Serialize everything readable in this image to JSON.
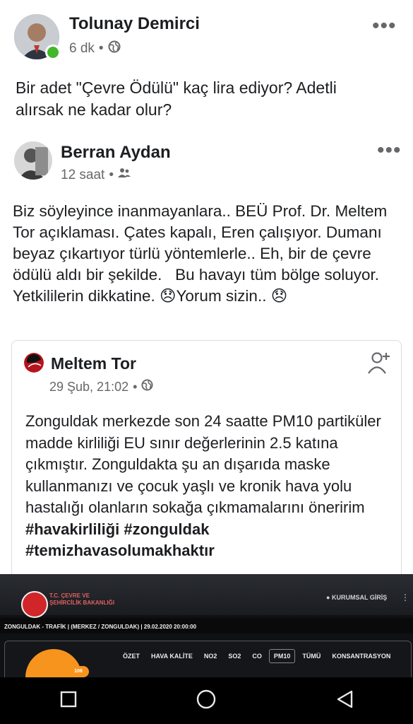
{
  "post": {
    "author": "Tolunay Demirci",
    "time": "6 dk",
    "privacy_icon": "globe-icon",
    "text": "Bir adet \"Çevre Ödülü\" kaç lira ediyor? Adetli alırsak ne kadar olur?"
  },
  "shared": {
    "author": "Berran Aydan",
    "time": "12 saat",
    "privacy_icon": "friends-icon",
    "text": "Biz söyleyince inanmayanlara.. BEÜ Prof. Dr. Meltem Tor açıklaması. Çates kapalı, Eren çalışıyor. Dumanı beyaz çıkartıyor türlü yöntemlerle.. Eh, bir de çevre ödülü aldı bir şekilde.   Bu havayı tüm bölge soluyor. Yetkililerin dikkatine. 😞Yorum sizin.. 😞"
  },
  "inner": {
    "author": "Meltem Tor",
    "time": "29 Şub, 21:02",
    "privacy_icon": "globe-icon",
    "text": "Zonguldak merkezde son 24 saatte PM10 partiküler madde kirliliği EU sınır değerlerinin 2.5 katına çıkmıştır. Zonguldakta şu an dışarıda maske kullanmanızı ve çocuk yaşlı ve kronik hava yolu hastalığı olanların sokağa çıkmamalarını öneririm ",
    "hashtag1": "#havakirliliği",
    "hashtag2": "#zonguldak",
    "hashtag3": "#temizhavasolumakhaktır"
  },
  "screenshot": {
    "ministry_line1": "T.C. ÇEVRE VE",
    "ministry_line2": "ŞEHİRCİLİK BAKANLIĞI",
    "login_label": "KURUMSAL GİRİŞ",
    "station_line": "ZONGULDAK - TRAFİK  |  (MERKEZ / ZONGULDAK)  |  29.02.2020 20:00:00",
    "badge_value": "106",
    "tabs": [
      "ÖZET",
      "HAVA KALİTE",
      "NO2",
      "SO2",
      "CO",
      "PM10",
      "TÜMÜ",
      "KONSANTRASYON"
    ]
  },
  "colors": {
    "online": "#42b72a",
    "text": "#1c1e21",
    "meta": "#65676b",
    "orange": "#f7941d"
  }
}
